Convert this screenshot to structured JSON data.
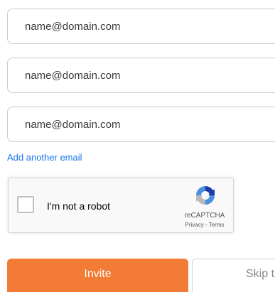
{
  "emails": [
    {
      "placeholder": "name@domain.com",
      "value": ""
    },
    {
      "placeholder": "name@domain.com",
      "value": ""
    },
    {
      "placeholder": "name@domain.com",
      "value": ""
    }
  ],
  "add_email_label": "Add another email",
  "recaptcha": {
    "checkbox_label": "I'm not a robot",
    "brand": "reCAPTCHA",
    "links": "Privacy - Terms",
    "logo_icon": "recaptcha-logo-icon"
  },
  "actions": {
    "invite_label": "Invite",
    "skip_label": "Skip t"
  },
  "colors": {
    "accent": "#f27b35",
    "link": "#1a73e8",
    "recaptcha_blue": "#1c3aa9",
    "recaptcha_light_blue": "#4a90e2"
  }
}
